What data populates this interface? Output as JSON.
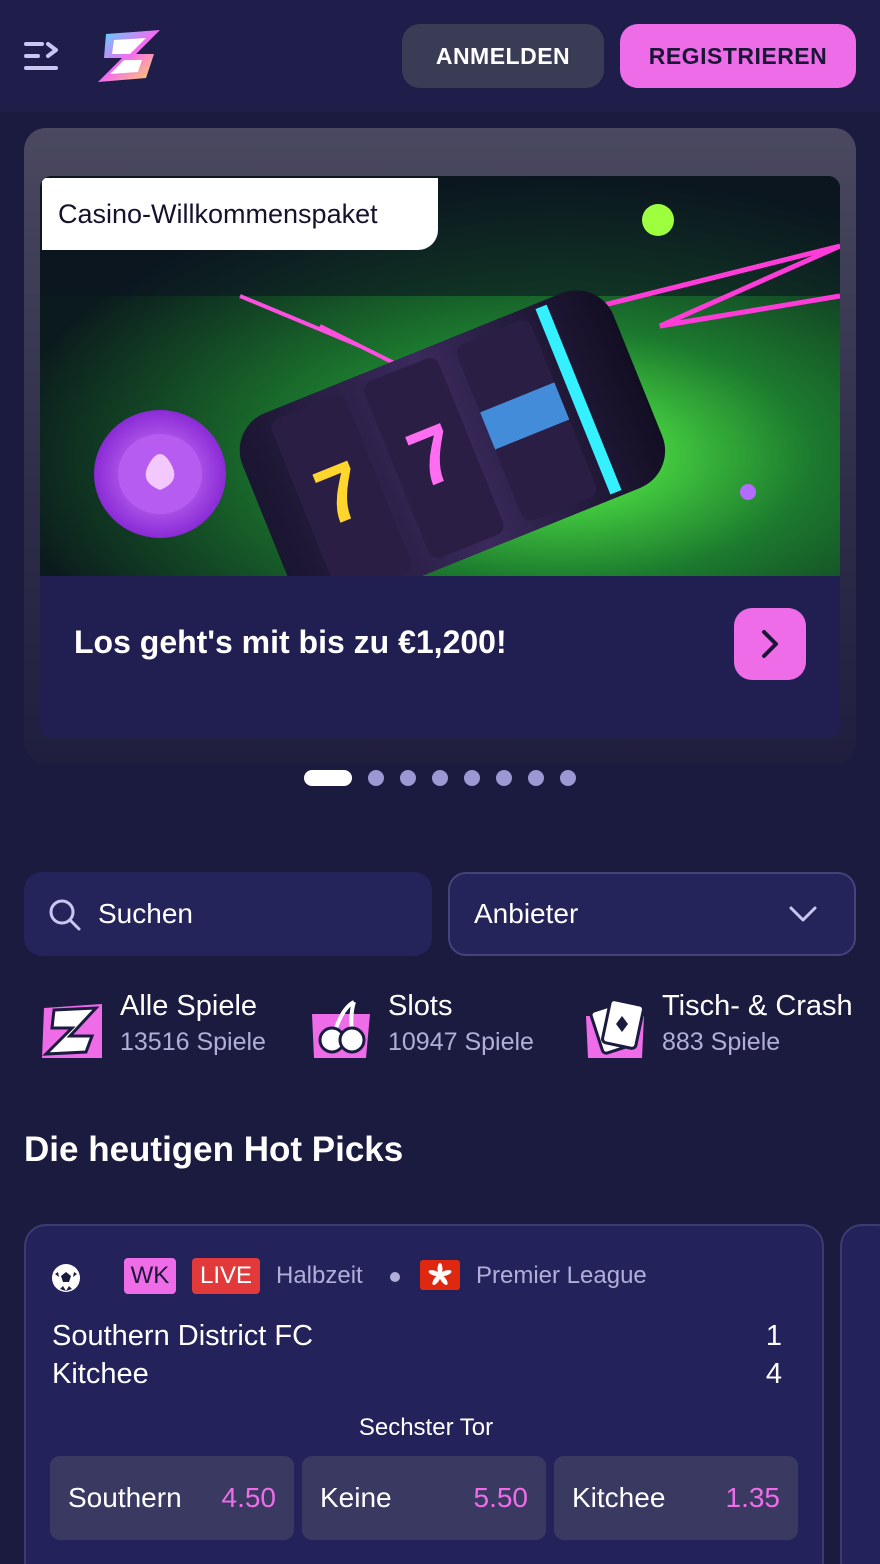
{
  "header": {
    "login_label": "ANMELDEN",
    "register_label": "REGISTRIEREN"
  },
  "banner": {
    "tag": "Casino-Willkommenspaket",
    "headline": "Los geht's mit bis zu €1,200!",
    "slides_total": 8,
    "active_slide": 1
  },
  "search": {
    "placeholder": "Suchen"
  },
  "provider_filter": {
    "label": "Anbieter"
  },
  "categories": [
    {
      "title": "Alle Spiele",
      "count": "13516 Spiele",
      "icon": "z-logo-icon"
    },
    {
      "title": "Slots",
      "count": "10947 Spiele",
      "icon": "cherries-icon"
    },
    {
      "title": "Tisch- & Crash",
      "count": "883 Spiele",
      "icon": "cards-icon"
    }
  ],
  "hot_picks": {
    "title": "Die heutigen Hot Picks",
    "match": {
      "sport_icon": "soccer-ball-icon",
      "badge_wk": "WK",
      "badge_live": "LIVE",
      "status": "Halbzeit",
      "flag_icon": "hong-kong-flag-icon",
      "league": "Premier League",
      "home_team": "Southern District FC",
      "away_team": "Kitchee",
      "home_score": "1",
      "away_score": "4",
      "market": "Sechster Tor",
      "odds": [
        {
          "label": "Southern",
          "value": "4.50"
        },
        {
          "label": "Keine",
          "value": "5.50"
        },
        {
          "label": "Kitchee",
          "value": "1.35"
        }
      ]
    }
  },
  "colors": {
    "background": "#1b1a3f",
    "header": "#1f1e4b",
    "accent_pink": "#ef6ce9",
    "card": "#23225a",
    "live_red": "#e23a3a"
  }
}
